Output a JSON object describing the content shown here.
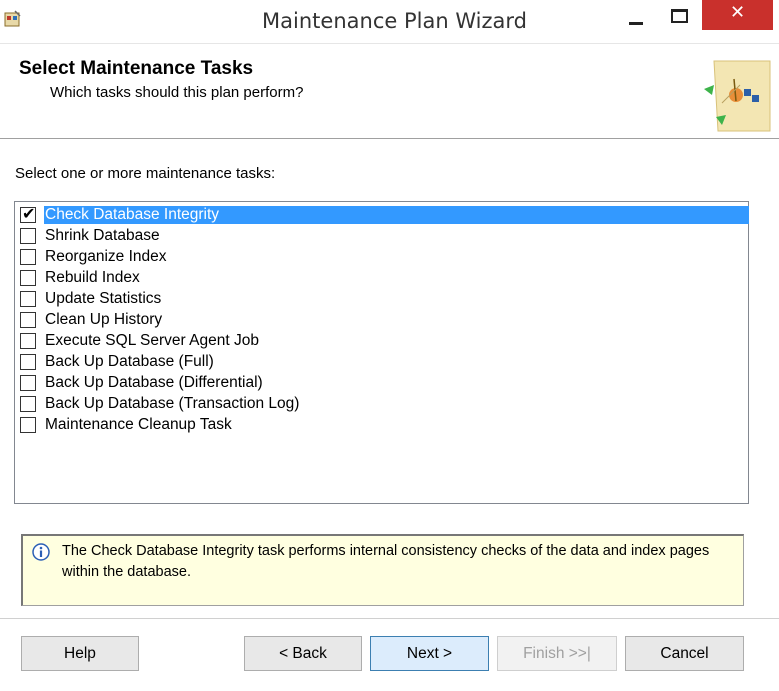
{
  "window": {
    "title": "Maintenance Plan Wizard",
    "close_glyph": "✕",
    "icons": {
      "app": "wizard-app-icon",
      "minimize": "minimize-icon",
      "maximize": "maximize-icon",
      "close": "close-icon"
    }
  },
  "header": {
    "title": "Select Maintenance Tasks",
    "subtitle": "Which tasks should this plan perform?",
    "graphic": "wizard-banner-graphic"
  },
  "main": {
    "caption": "Select one or more maintenance tasks:",
    "tasks": [
      {
        "label": "Check Database Integrity",
        "checked": true,
        "selected": true
      },
      {
        "label": "Shrink Database",
        "checked": false,
        "selected": false
      },
      {
        "label": "Reorganize Index",
        "checked": false,
        "selected": false
      },
      {
        "label": "Rebuild Index",
        "checked": false,
        "selected": false
      },
      {
        "label": "Update Statistics",
        "checked": false,
        "selected": false
      },
      {
        "label": "Clean Up History",
        "checked": false,
        "selected": false
      },
      {
        "label": "Execute SQL Server Agent Job",
        "checked": false,
        "selected": false
      },
      {
        "label": "Back Up Database (Full)",
        "checked": false,
        "selected": false
      },
      {
        "label": "Back Up Database (Differential)",
        "checked": false,
        "selected": false
      },
      {
        "label": "Back Up Database (Transaction Log)",
        "checked": false,
        "selected": false
      },
      {
        "label": "Maintenance Cleanup Task",
        "checked": false,
        "selected": false
      }
    ],
    "check_glyph": "✔",
    "info": {
      "icon": "info-icon",
      "text": "The Check Database Integrity task performs internal consistency checks of the data and index pages within the database."
    }
  },
  "buttons": {
    "help": "Help",
    "back": "< Back",
    "next": "Next >",
    "finish": "Finish >>|",
    "cancel": "Cancel"
  },
  "colors": {
    "selection": "#3399ff",
    "info_background": "#ffffe0",
    "close_button": "#c9302c",
    "default_button": "#dcecfc"
  }
}
